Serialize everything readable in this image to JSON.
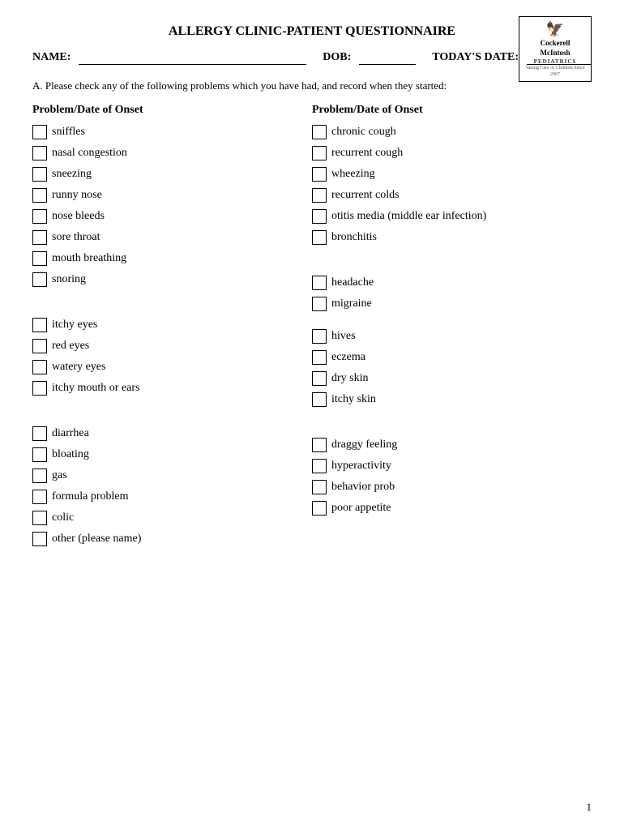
{
  "header": {
    "title": "ALLERGY CLINIC-PATIENT QUESTIONNAIRE",
    "logo": {
      "icon": "🦅",
      "name1": "Cockerell",
      "name2": "McIntosh",
      "sub": "PEDIATRICS",
      "tagline": "Taking Care of Children Since 2007"
    }
  },
  "form": {
    "name_label": "NAME:",
    "dob_label": "DOB:",
    "date_label": "TODAY'S DATE:"
  },
  "instruction": "A.  Please check any of the following problems which you have had, and record when they started:",
  "col_header": "Problem/Date of Onset",
  "left_items": [
    "sniffles",
    "nasal congestion",
    "sneezing",
    "runny nose",
    "nose bleeds",
    "sore throat",
    "mouth breathing",
    "snoring",
    "itchy eyes",
    "red eyes",
    "watery eyes",
    "itchy mouth or ears",
    "diarrhea",
    "bloating",
    "gas",
    "formula problem",
    "colic",
    "other (please name)"
  ],
  "right_items": [
    "chronic cough",
    "recurrent cough",
    "wheezing",
    "recurrent colds",
    "otitis media (middle ear infection)",
    "bronchitis",
    "headache",
    "migraine",
    "hives",
    "eczema",
    "dry skin",
    "itchy skin",
    "draggy feeling",
    "hyperactivity",
    "behavior prob",
    "poor appetite"
  ],
  "right_spacers": {
    "after_bronchitis": true,
    "after_migraine": false,
    "after_itchy_skin": true
  },
  "page_number": "1"
}
